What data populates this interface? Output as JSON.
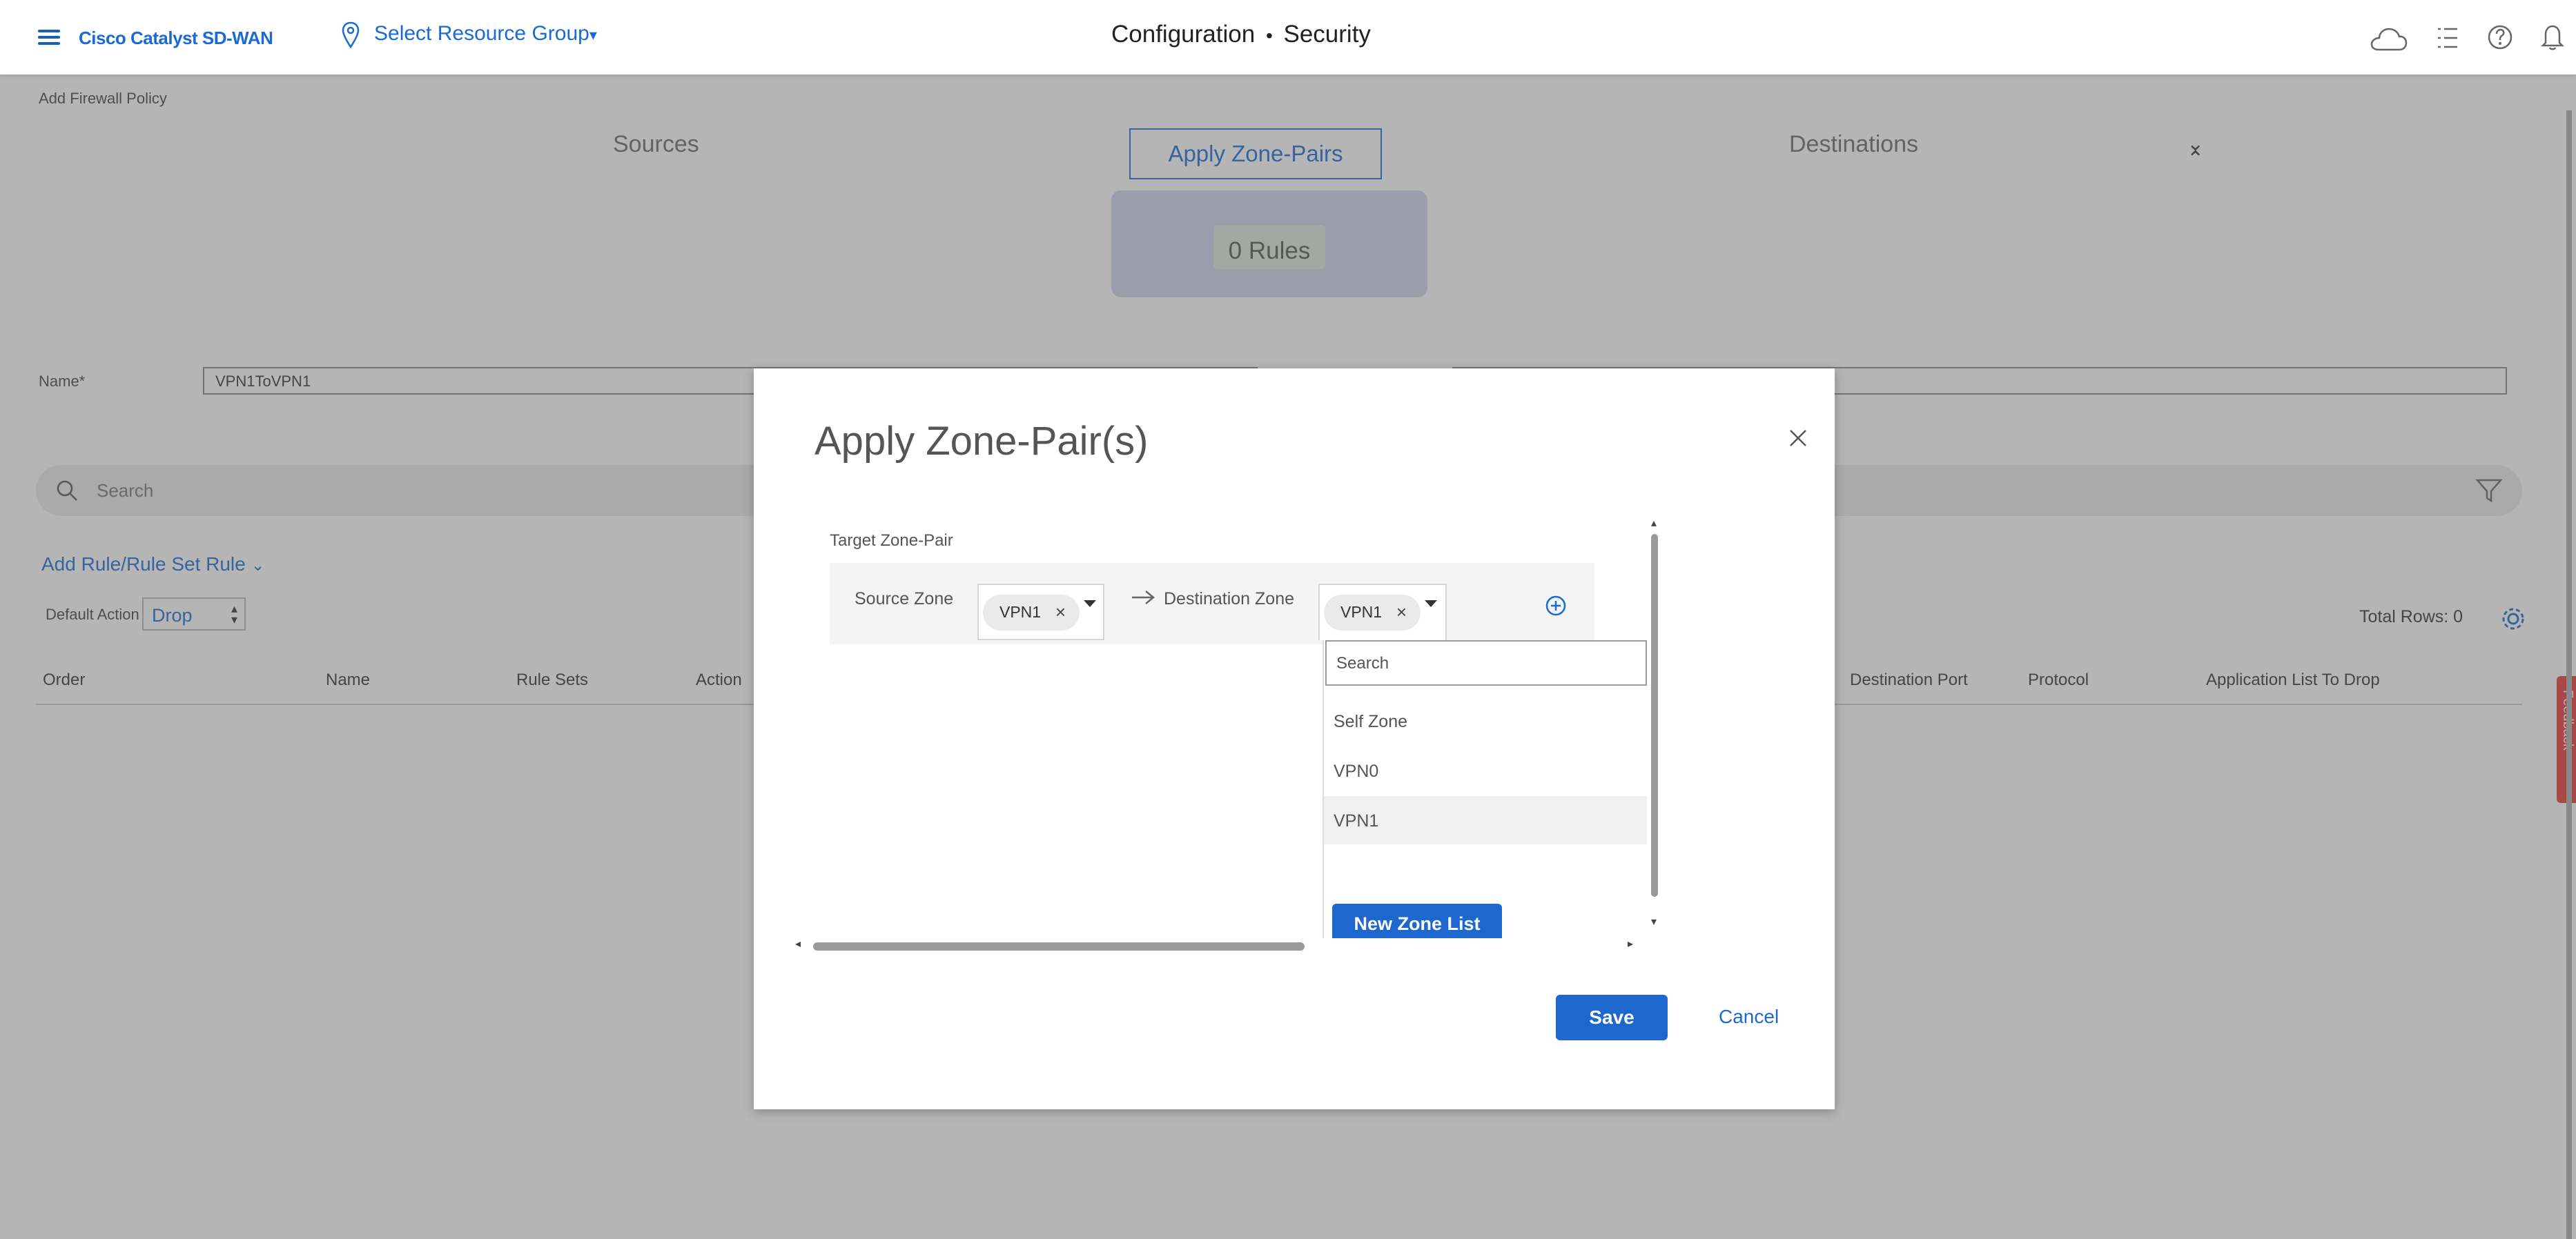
{
  "header": {
    "brand": "Cisco Catalyst SD-WAN",
    "resource_group": "Select Resource Group",
    "title_main": "Configuration",
    "title_sep": "•",
    "title_sub": "Security"
  },
  "page": {
    "breadcrumb": "Add Firewall Policy",
    "tabs": [
      "Sources",
      "Apply Zone-Pairs",
      "Destinations"
    ],
    "rules_count": "0 Rules",
    "name_label": "Name*",
    "name_value": "VPN1ToVPN1",
    "search_placeholder": "Search",
    "add_rule_label": "Add Rule/Rule Set Rule",
    "default_action_label": "Default Action",
    "default_action_value": "Drop",
    "total_rows": "Total Rows: 0",
    "columns_left": [
      "Order",
      "Name",
      "Rule Sets",
      "Action"
    ],
    "columns_right": [
      "Destination Port",
      "Protocol",
      "Application List To Drop"
    ],
    "feedback": "Feedback"
  },
  "modal": {
    "title": "Apply Zone-Pair(s)",
    "section_label": "Target Zone-Pair",
    "source_label": "Source Zone",
    "source_value": "VPN1",
    "dest_label": "Destination Zone",
    "dest_value": "VPN1",
    "dropdown_search_placeholder": "Search",
    "dropdown_options": [
      "Self Zone",
      "VPN0",
      "VPN1"
    ],
    "new_zone_list": "New Zone List",
    "save": "Save",
    "cancel": "Cancel"
  },
  "colors": {
    "accent": "#1d67cf",
    "overlay": "#5a5a5a",
    "feedback": "#e53935"
  }
}
